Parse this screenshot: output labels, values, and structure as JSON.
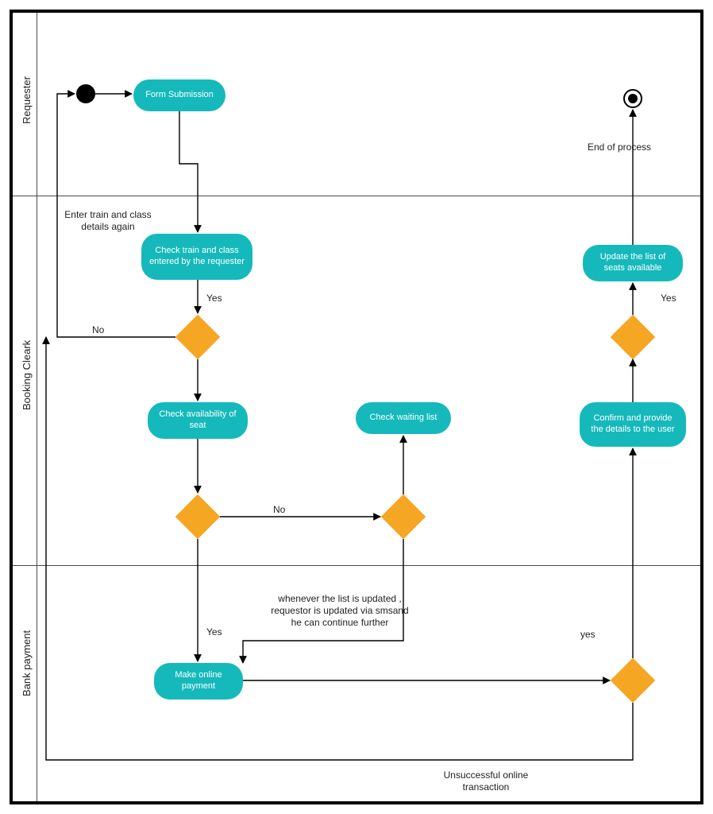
{
  "lanes": {
    "requester": "Requester",
    "booking_cleark": "Booking Cleark",
    "bank_payment": "Bank payment"
  },
  "activities": {
    "form_submission": "Form Submission",
    "check_train_class": "Check train and class entered by the requester",
    "check_seat": "Check availability of seat",
    "check_waiting": "Check waiting list",
    "make_payment": "Make online payment",
    "confirm_details": "Confirm and provide the details to the user",
    "update_seats": "Update the list of seats available"
  },
  "labels": {
    "end_of_process": "End of process",
    "enter_again": "Enter train and class\ndetails again",
    "yes1": "Yes",
    "no1": "No",
    "no2": "No",
    "yes2": "Yes",
    "yes3": "Yes",
    "yes4": "yes",
    "sms_note": "whenever the list is updated ,\nrequestor is updated via smsand\nhe can continue further",
    "unsuccessful": "Unsuccessful online\ntransaction"
  },
  "colors": {
    "activity": "#16b9bb",
    "decision": "#f5a623",
    "border": "#000000"
  }
}
